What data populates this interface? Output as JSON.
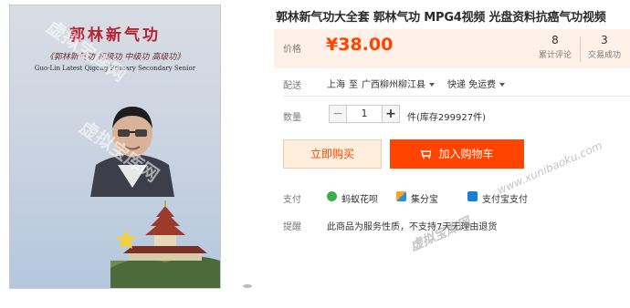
{
  "product": {
    "title": "郭林新气功大全套 郭林气功 MPG4视频 光盘资料抗癌气功视频",
    "cover": {
      "title": "郭林新气功",
      "subtitle": "《郭林新气功 初级功 中级功 高级功》",
      "english": "Guo-Lin Latest Qigong Primary Secondary Senior"
    }
  },
  "price_box": {
    "label": "价格",
    "price": "¥38.00",
    "reviews_count": "8",
    "reviews_label": "累计评论",
    "sales_count": "3",
    "sales_label": "交易成功"
  },
  "shipping": {
    "label": "配送",
    "from": "上海",
    "to_word": "至",
    "destination": "广西柳州柳江县",
    "method": "快递 免运费"
  },
  "quantity": {
    "label": "数量",
    "minus": "−",
    "value": "1",
    "plus": "+",
    "stock": "件(库存299927件)"
  },
  "actions": {
    "buy_now": "立即购买",
    "add_to_cart": "加入购物车"
  },
  "payment": {
    "label": "支付",
    "methods": [
      "蚂蚁花呗",
      "集分宝",
      "支付宝支付"
    ]
  },
  "notice": {
    "label": "提醒",
    "text": "此商品为服务性质，不支持7天无理由退货"
  },
  "watermark": {
    "url": "www.xunibaoku.com",
    "brand": "虚拟宝库网"
  },
  "colors": {
    "accent": "#ff4400",
    "price_bg": "#fff1e8",
    "buy_now_bg": "#ffeedb"
  }
}
